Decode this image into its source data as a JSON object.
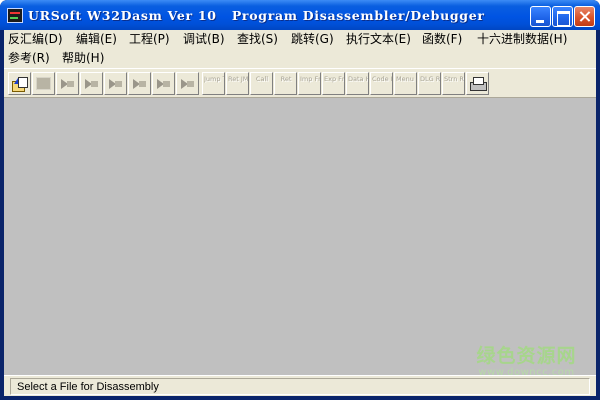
{
  "window": {
    "title": "URSoft W32Dasm Ver 10   Program Disassembler/Debugger"
  },
  "menubar": {
    "items": [
      "反汇编(D)",
      "编辑(E)",
      "工程(P)",
      "调试(B)",
      "查找(S)",
      "跳转(G)",
      "执行文本(E)",
      "函数(F)",
      "十六进制数据(H)",
      "参考(R)",
      "帮助(H)"
    ]
  },
  "toolbar": {
    "tools": [
      {
        "name": "open-file",
        "label": "",
        "enabled": true
      },
      {
        "name": "save",
        "label": "",
        "enabled": false
      },
      {
        "name": "search",
        "label": "",
        "enabled": false
      },
      {
        "name": "step",
        "label": "",
        "enabled": false
      },
      {
        "name": "goto",
        "label": "",
        "enabled": false
      },
      {
        "name": "goto-cursor",
        "label": "",
        "enabled": false
      },
      {
        "name": "nav-back",
        "label": "",
        "enabled": false
      },
      {
        "name": "nav-forward",
        "label": "",
        "enabled": false
      },
      {
        "name": "jump-to",
        "label": "Jump To",
        "enabled": false
      },
      {
        "name": "ret-jmp",
        "label": "Ret JMP",
        "enabled": false
      },
      {
        "name": "call",
        "label": "Call",
        "enabled": false
      },
      {
        "name": "ret",
        "label": "Ret",
        "enabled": false
      },
      {
        "name": "imp-fn",
        "label": "Imp Fn",
        "enabled": false
      },
      {
        "name": "exp-fn",
        "label": "Exp Fn",
        "enabled": false
      },
      {
        "name": "data-hex",
        "label": "Data Hex",
        "enabled": false
      },
      {
        "name": "code-hex",
        "label": "Code Hex",
        "enabled": false
      },
      {
        "name": "menu-ref",
        "label": "Menu REF",
        "enabled": false
      },
      {
        "name": "dlg-ref",
        "label": "DLG REF",
        "enabled": false
      },
      {
        "name": "strn-ref",
        "label": "Strn REF",
        "enabled": false
      },
      {
        "name": "print",
        "label": "",
        "enabled": true
      }
    ]
  },
  "statusbar": {
    "text": "Select a File for Disassembly"
  },
  "watermark": {
    "main": "绿色资源网",
    "sub": "www.downcc.com"
  }
}
